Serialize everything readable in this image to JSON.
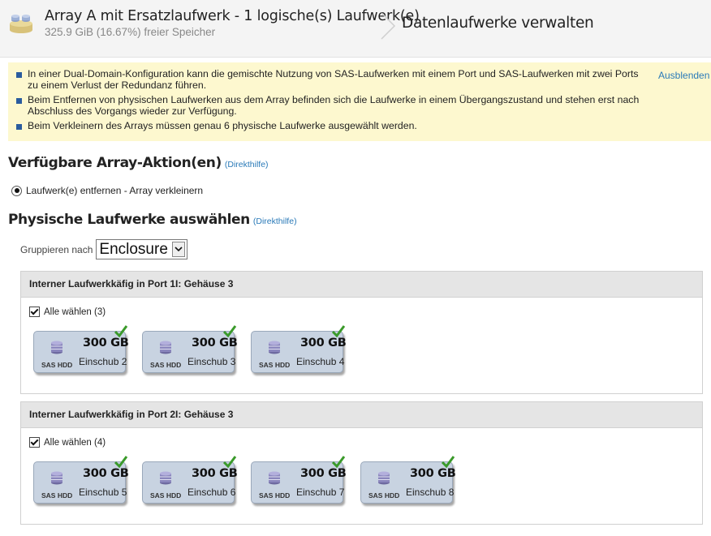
{
  "header": {
    "title": "Array A mit Ersatzlaufwerk - 1 logische(s) Laufwerk(e)",
    "subtitle": "325.9 GiB (16.67%) freier Speicher",
    "page_title": "Datenlaufwerke verwalten"
  },
  "info": {
    "messages": [
      "In einer Dual-Domain-Konfiguration kann die gemischte Nutzung von SAS-Laufwerken mit einem Port und SAS-Laufwerken mit zwei Ports zu einem Verlust der Redundanz führen.",
      "Beim Entfernen von physischen Laufwerken aus dem Array befinden sich die Laufwerke in einem Übergangszustand und stehen erst nach Abschluss des Vorgangs wieder zur Verfügung.",
      "Beim Verkleinern des Arrays müssen genau 6 physische Laufwerke ausgewählt werden."
    ],
    "hide_label": "Ausblenden"
  },
  "actions": {
    "heading": "Verfügbare Array-Aktion(en)",
    "help": "(Direkthilfe)",
    "option": "Laufwerk(e) entfernen - Array verkleinern"
  },
  "drives_section": {
    "heading": "Physische Laufwerke auswählen",
    "help": "(Direkthilfe)",
    "group_label": "Gruppieren nach",
    "group_value": "Enclosure"
  },
  "enclosures": [
    {
      "title": "Interner Laufwerkkäfig in Port 1I: Gehäuse 3",
      "select_all": "Alle wählen (3)",
      "drives": [
        {
          "capacity": "300 GB",
          "bay": "Einschub 2",
          "type": "SAS HDD"
        },
        {
          "capacity": "300 GB",
          "bay": "Einschub 3",
          "type": "SAS HDD"
        },
        {
          "capacity": "300 GB",
          "bay": "Einschub 4",
          "type": "SAS HDD"
        }
      ]
    },
    {
      "title": "Interner Laufwerkkäfig in Port 2I: Gehäuse 3",
      "select_all": "Alle wählen (4)",
      "drives": [
        {
          "capacity": "300 GB",
          "bay": "Einschub 5",
          "type": "SAS HDD"
        },
        {
          "capacity": "300 GB",
          "bay": "Einschub 6",
          "type": "SAS HDD"
        },
        {
          "capacity": "300 GB",
          "bay": "Einschub 7",
          "type": "SAS HDD"
        },
        {
          "capacity": "300 GB",
          "bay": "Einschub 8",
          "type": "SAS HDD"
        }
      ]
    }
  ],
  "icons": {
    "array": "array-icon",
    "drive": "disk-stack-icon",
    "selected": "checkmark-icon",
    "separator": "chevron-right-icon"
  },
  "colors": {
    "info_bg": "#fdf8cf",
    "link": "#2a7ab8",
    "drive_bg": "#c8d3e1",
    "check": "#3a9a2a"
  }
}
